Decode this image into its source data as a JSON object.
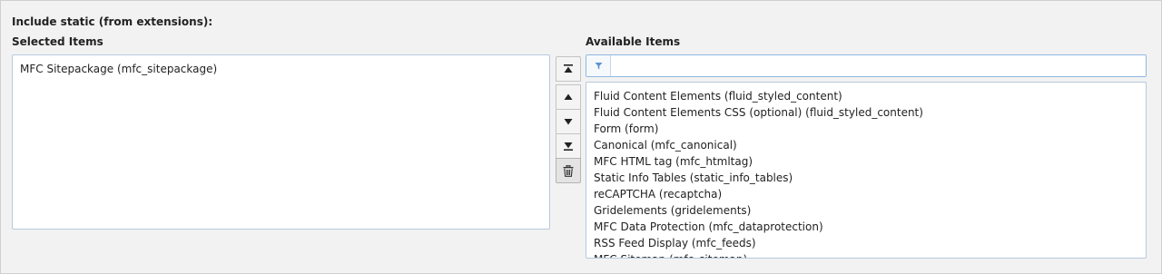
{
  "section": {
    "title": "Include static (from extensions):"
  },
  "selected": {
    "label": "Selected Items",
    "items": [
      "MFC Sitepackage (mfc_sitepackage)"
    ]
  },
  "controls": {
    "icons": [
      "move-to-top-icon",
      "move-up-icon",
      "move-down-icon",
      "move-to-bottom-icon",
      "trash-icon"
    ]
  },
  "available": {
    "label": "Available Items",
    "filter": {
      "value": "",
      "icon": "filter-icon"
    },
    "items": [
      "Fluid Content Elements (fluid_styled_content)",
      "Fluid Content Elements CSS (optional) (fluid_styled_content)",
      "Form (form)",
      "Canonical (mfc_canonical)",
      "MFC HTML tag (mfc_htmltag)",
      "Static Info Tables (static_info_tables)",
      "reCAPTCHA (recaptcha)",
      "Gridelements (gridelements)",
      "MFC Data Protection (mfc_dataprotection)",
      "RSS Feed Display (mfc_feeds)",
      "MFC Sitemap (mfc_sitemap)"
    ]
  },
  "colors": {
    "accent": "#6d9fd6",
    "border": "#b6c9dd"
  }
}
